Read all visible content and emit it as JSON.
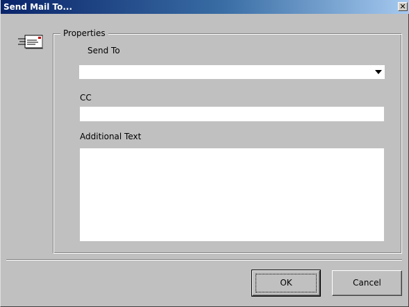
{
  "window": {
    "title": "Send Mail To...",
    "close_glyph": "✕"
  },
  "properties": {
    "legend": "Properties",
    "send_to": {
      "label": "Send To",
      "value": ""
    },
    "cc": {
      "label": "CC",
      "value": ""
    },
    "additional_text": {
      "label": "Additional Text",
      "value": ""
    }
  },
  "buttons": {
    "ok_label": "OK",
    "cancel_label": "Cancel"
  },
  "icons": {
    "mail": "mail-icon",
    "close": "close-icon",
    "dropdown": "chevron-down-icon"
  }
}
